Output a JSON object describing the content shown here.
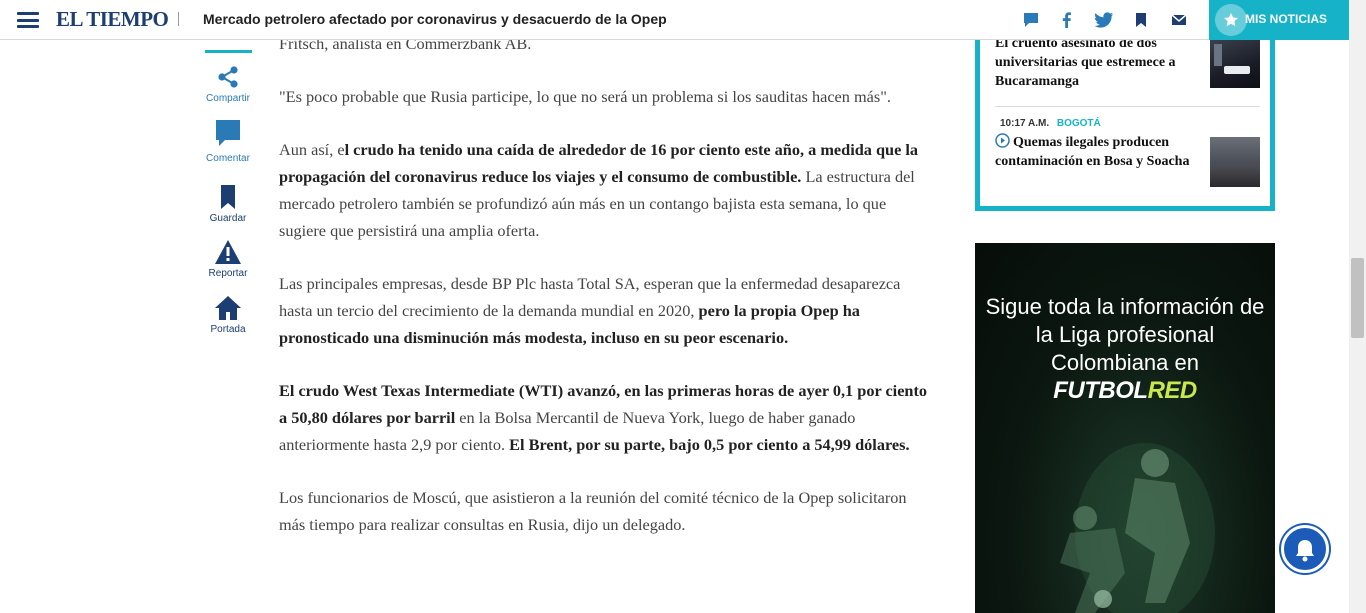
{
  "header": {
    "logo": "EL TIEMPO",
    "headline": "Mercado petrolero afectado por coronavirus y desacuerdo de la Opep",
    "mis_noticias": "MIS NOTICIAS",
    "icons": [
      "comment-icon",
      "facebook-icon",
      "twitter-icon",
      "bookmark-icon",
      "mail-icon"
    ]
  },
  "rail": {
    "items": [
      {
        "label": "Compartir",
        "icon": "share-icon",
        "color": "#2a7ab8"
      },
      {
        "label": "Comentar",
        "icon": "comment-icon",
        "color": "#2a7ab8"
      },
      {
        "label": "Guardar",
        "icon": "bookmark-icon",
        "color": "#1c3e73"
      },
      {
        "label": "Reportar",
        "icon": "warning-icon",
        "color": "#1c3e73"
      },
      {
        "label": "Portada",
        "icon": "home-icon",
        "color": "#1c3e73"
      }
    ]
  },
  "article": {
    "p0": "Fritsch, analista en Commerzbank AB.",
    "p1": "\"Es poco probable que Rusia participe, lo que no será un problema si los sauditas hacen más\".",
    "p2a": "Aun así, e",
    "p2b": "l crudo ha tenido una caída de alrededor de 16 por ciento este año, a medida que la propagación del coronavirus reduce los viajes y el consumo de combustible.",
    "p2c": " La estructura del mercado petrolero también se profundizó aún más en un contango bajista esta semana, lo que sugiere que persistirá una amplia oferta.",
    "p3a": "Las principales empresas, desde BP Plc hasta Total SA, esperan que la enfermedad desaparezca hasta un tercio del crecimiento de la demanda mundial en 2020, ",
    "p3b": "pero la propia Opep ha pronosticado una disminución más modesta, incluso en su peor escenario.",
    "p4a": "El crudo West Texas Intermediate (WTI) avanzó, en las primeras horas de ayer 0,1 por ciento a 50,80 dólares por barril",
    "p4b": " en la Bolsa Mercantil de Nueva York, luego de haber ganado anteriormente hasta 2,9 por ciento. ",
    "p4c": "El Brent, por su parte, bajo 0,5 por ciento a 54,99 dólares.",
    "p5": "Los funcionarios de Moscú, que asistieron a la reunión del comité técnico de la Opep solicitaron más tiempo para realizar consultas en Rusia, dijo un delegado."
  },
  "sidebar": {
    "news": [
      {
        "time": "",
        "category": "",
        "title": "El cruento asesinato de dos universitarias que estremece a Bucaramanga"
      },
      {
        "time": "10:17 A.M.",
        "category": "BOGOTÁ",
        "title": "Quemas ilegales producen contaminación en Bosa y Soacha"
      }
    ]
  },
  "ad": {
    "text": "Sigue toda la información de la Liga profesional Colombiana en",
    "brand_a": "FUTBOL",
    "brand_b": "RED"
  },
  "colors": {
    "brand": "#1c3e73",
    "accent": "#16b3c8",
    "bell": "#1c5bb7"
  }
}
